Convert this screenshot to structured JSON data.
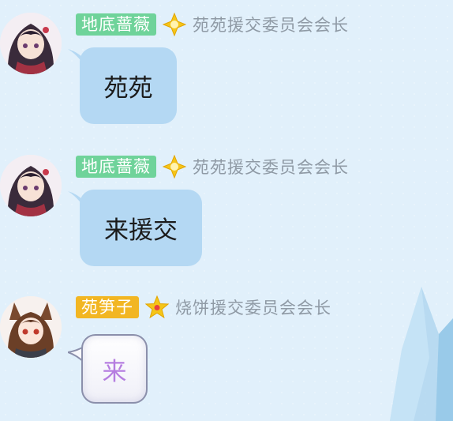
{
  "colors": {
    "background": "#e1f0fb",
    "bubble_blue": "#b4d8f3",
    "tag_green": "#6fd39a",
    "tag_yellow": "#f2b623",
    "title_gray": "#8f9aa5"
  },
  "messages": [
    {
      "nickname": "地底蔷薇",
      "title": "苑苑援交委员会会长",
      "badge_icon": "yellow-diamond-star-icon",
      "text": "苑苑"
    },
    {
      "nickname": "地底蔷薇",
      "title": "苑苑援交委员会会长",
      "badge_icon": "yellow-diamond-star-icon",
      "text": "来援交"
    },
    {
      "nickname": "苑笋子",
      "title": "烧饼援交委员会会长",
      "badge_icon": "yellow-star-badge-icon",
      "text": "来"
    }
  ]
}
